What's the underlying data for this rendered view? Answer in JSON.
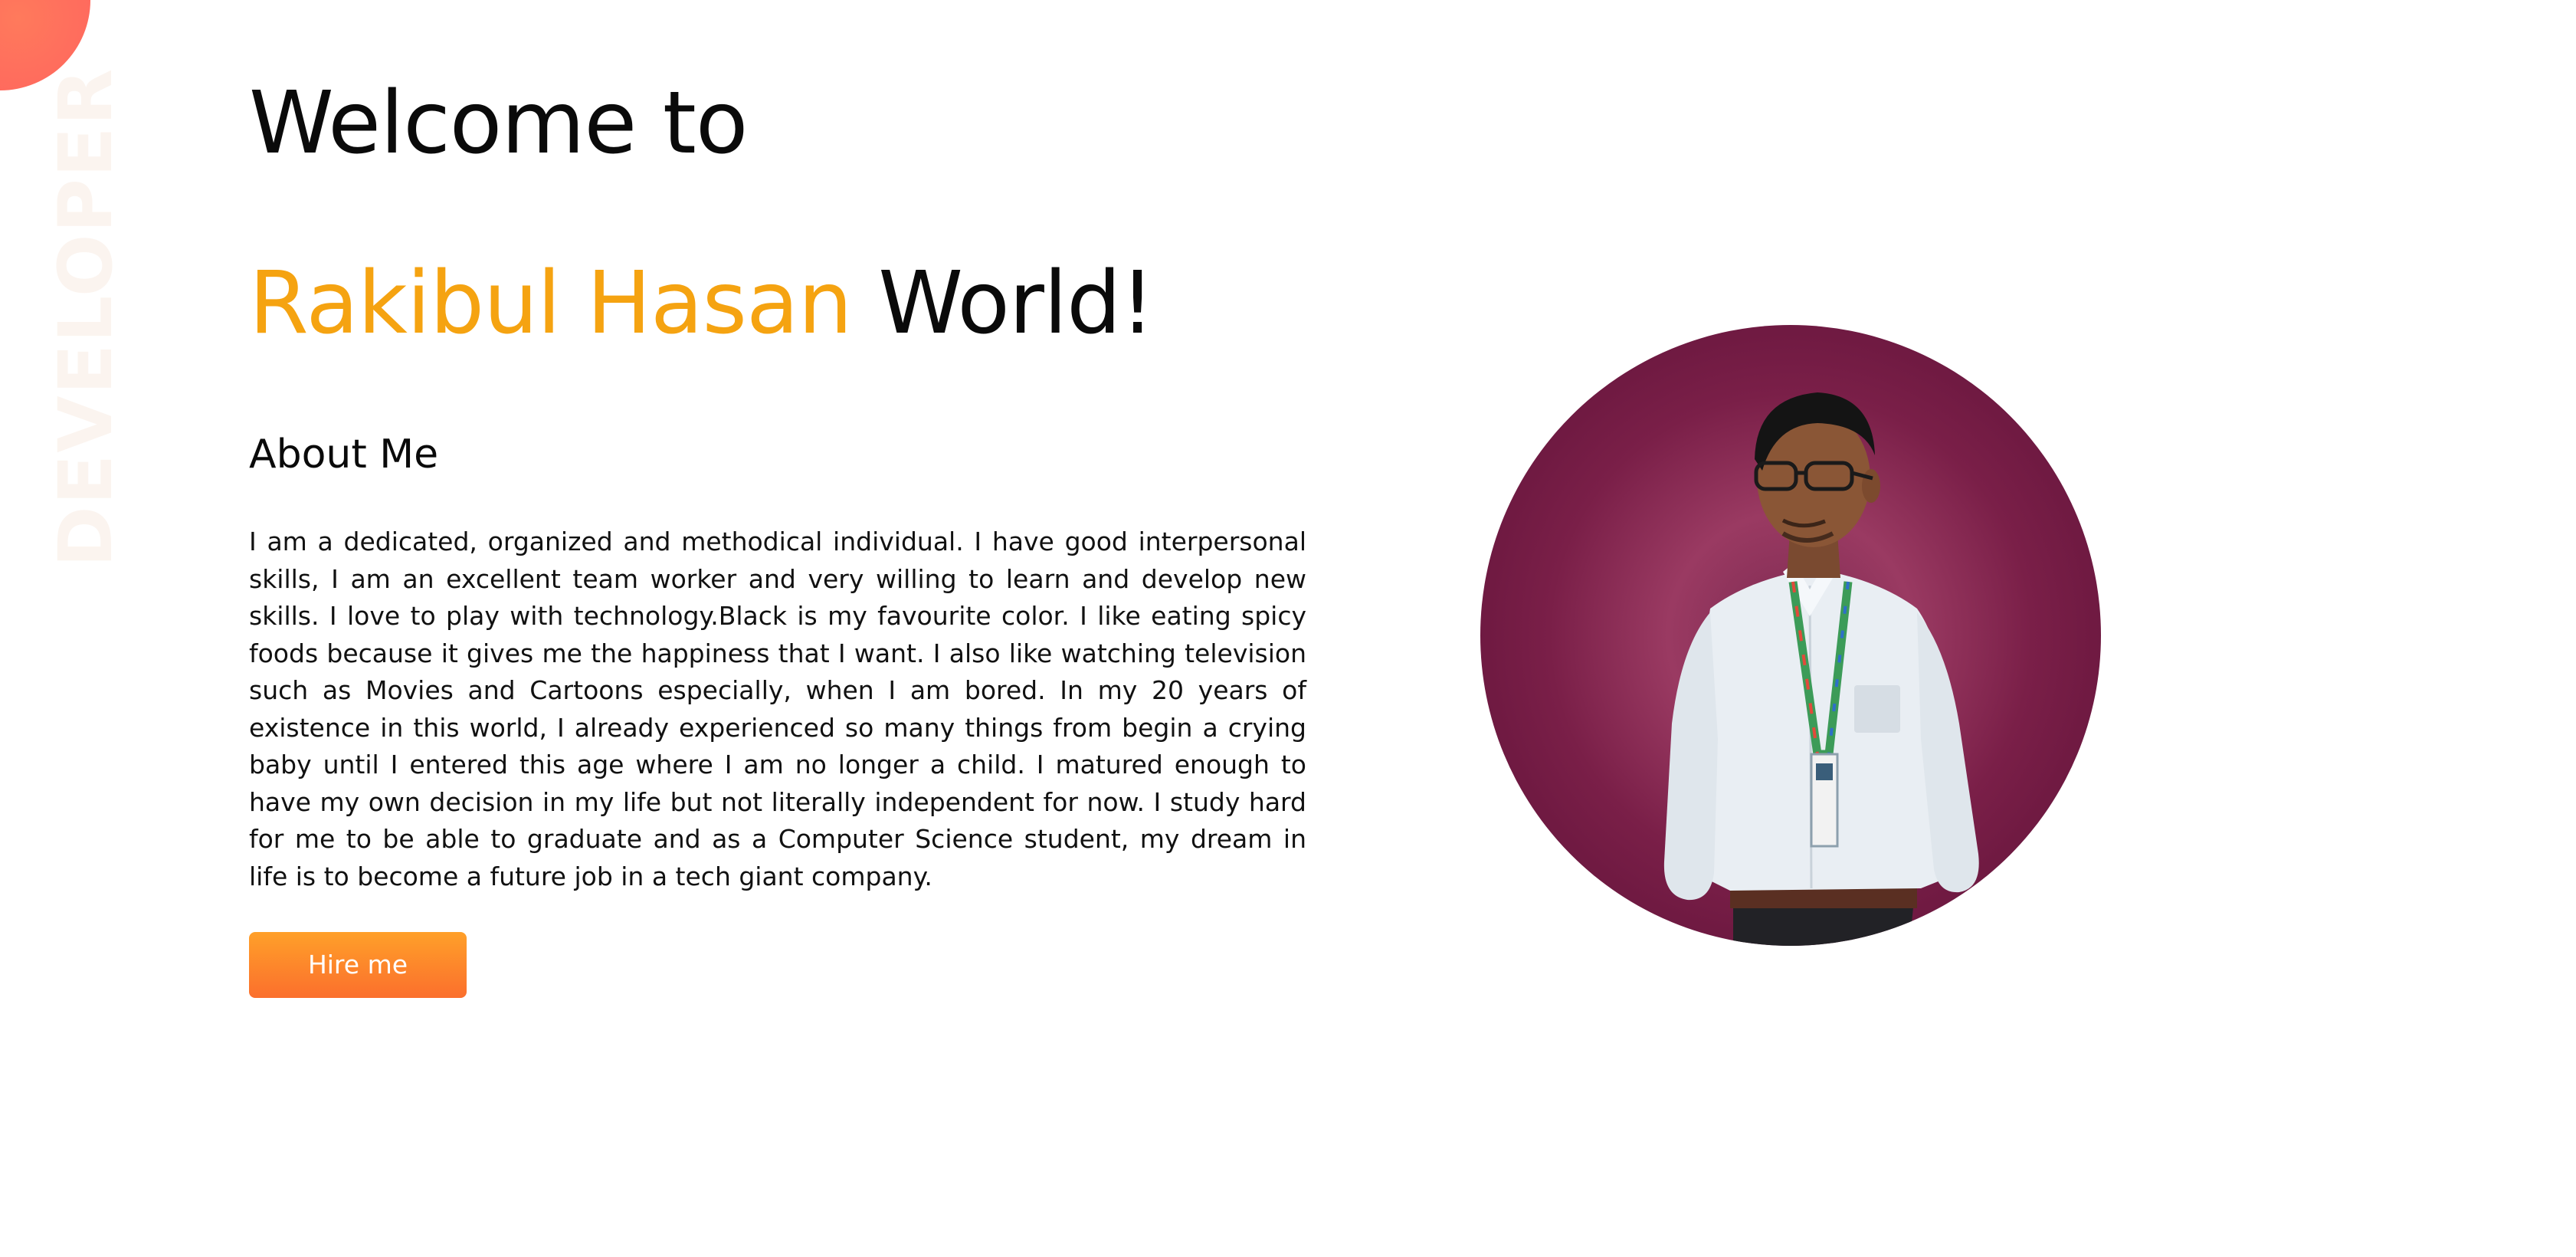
{
  "decor": {
    "side_text": "DEVELOPER"
  },
  "hero": {
    "welcome": "Welcome to",
    "name": "Rakibul Hasan",
    "world": "World!",
    "about_title": "About Me",
    "about_text": "I am a dedicated, organized and methodical individual. I have good interpersonal skills, I am an excellent team worker and very willing to learn and develop new skills. I love to play with technology.Black is my favourite color. I like eating spicy foods because it gives me the happiness that I want. I also like watching television such as Movies and Cartoons especially, when I am bored. In my 20 years of existence in this world, I already experienced so many things from begin a crying baby until I entered this age where I am no longer a child. I matured enough to have my own decision in my life but not literally independent for now. I study hard for me to be able to graduate and as a Computer Science student, my dream in life is to become a future job in a tech giant company.",
    "hire_button": "Hire me"
  },
  "colors": {
    "accent": "#f5a311",
    "button_top": "#ffa029",
    "button_bottom": "#fb6f2d",
    "portrait_bg": "#7a1f48",
    "corner_blob": "#ff5a5f"
  }
}
